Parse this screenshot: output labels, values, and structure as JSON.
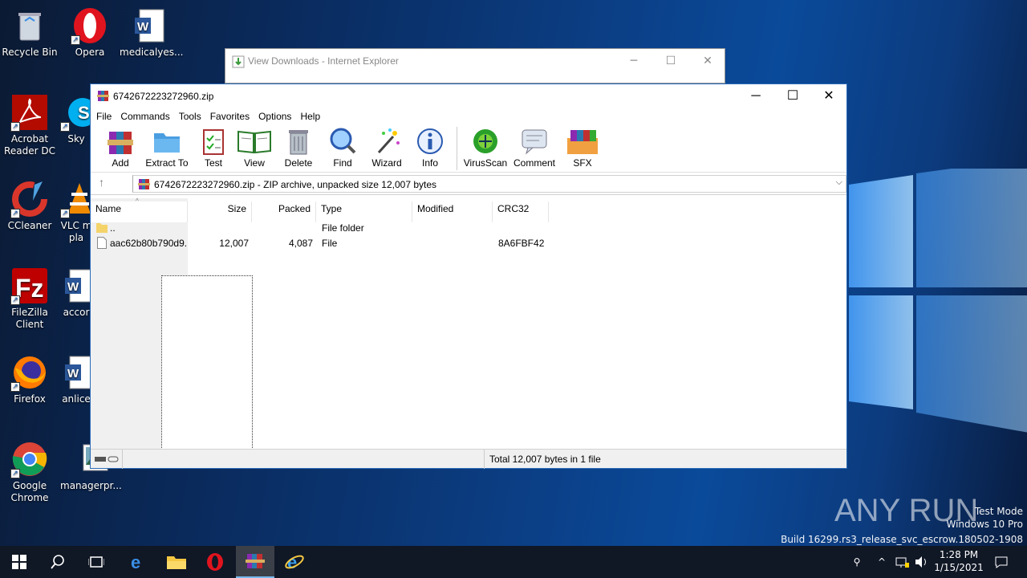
{
  "desktop": {
    "icons": [
      {
        "label": "Recycle Bin",
        "name": "recycle-bin-icon"
      },
      {
        "label": "Opera",
        "name": "opera-icon"
      },
      {
        "label": "medicalyes...",
        "name": "word-document-icon"
      },
      {
        "label": "Acrobat Reader DC",
        "name": "acrobat-icon"
      },
      {
        "label": "Sky",
        "name": "skype-icon"
      },
      {
        "label": "CCleaner",
        "name": "ccleaner-icon"
      },
      {
        "label": "VLC m pla",
        "name": "vlc-icon"
      },
      {
        "label": "FileZilla Client",
        "name": "filezilla-icon"
      },
      {
        "label": "accor",
        "name": "word-document-icon"
      },
      {
        "label": "Firefox",
        "name": "firefox-icon"
      },
      {
        "label": "anlice",
        "name": "word-document-icon"
      },
      {
        "label": "Google Chrome",
        "name": "chrome-icon"
      },
      {
        "label": "managerpr...",
        "name": "image-file-icon"
      }
    ]
  },
  "ie_window": {
    "title": "View Downloads - Internet Explorer",
    "minimize": "─",
    "maximize": "☐",
    "close": "✕"
  },
  "winrar": {
    "title": "6742672223272960.zip",
    "minimize": "─",
    "maximize": "☐",
    "close": "✕",
    "menu": [
      "File",
      "Commands",
      "Tools",
      "Favorites",
      "Options",
      "Help"
    ],
    "toolbar": [
      "Add",
      "Extract To",
      "Test",
      "View",
      "Delete",
      "Find",
      "Wizard",
      "Info",
      "VirusScan",
      "Comment",
      "SFX"
    ],
    "address": "6742672223272960.zip - ZIP archive, unpacked size 12,007 bytes",
    "columns": [
      "Name",
      "Size",
      "Packed",
      "Type",
      "Modified",
      "CRC32"
    ],
    "rows": [
      {
        "name": "..",
        "size": "",
        "packed": "",
        "type": "File folder",
        "modified": "",
        "crc": ""
      },
      {
        "name": "aac62b80b790d9...",
        "size": "12,007",
        "packed": "4,087",
        "type": "File",
        "modified": "",
        "crc": "8A6FBF42"
      }
    ],
    "status": "Total 12,007 bytes in 1 file"
  },
  "tray": {
    "time": "1:28 PM",
    "date": "1/15/2021"
  },
  "watermark": {
    "brand": "ANY RUN",
    "line1": "Test Mode",
    "line2": "Windows 10 Pro",
    "line3": "Build 16299.rs3_release_svc_escrow.180502-1908"
  },
  "colors": {
    "accent": "#2a6ab7",
    "desktop": "#0a3f86",
    "taskbar": "#101725"
  }
}
